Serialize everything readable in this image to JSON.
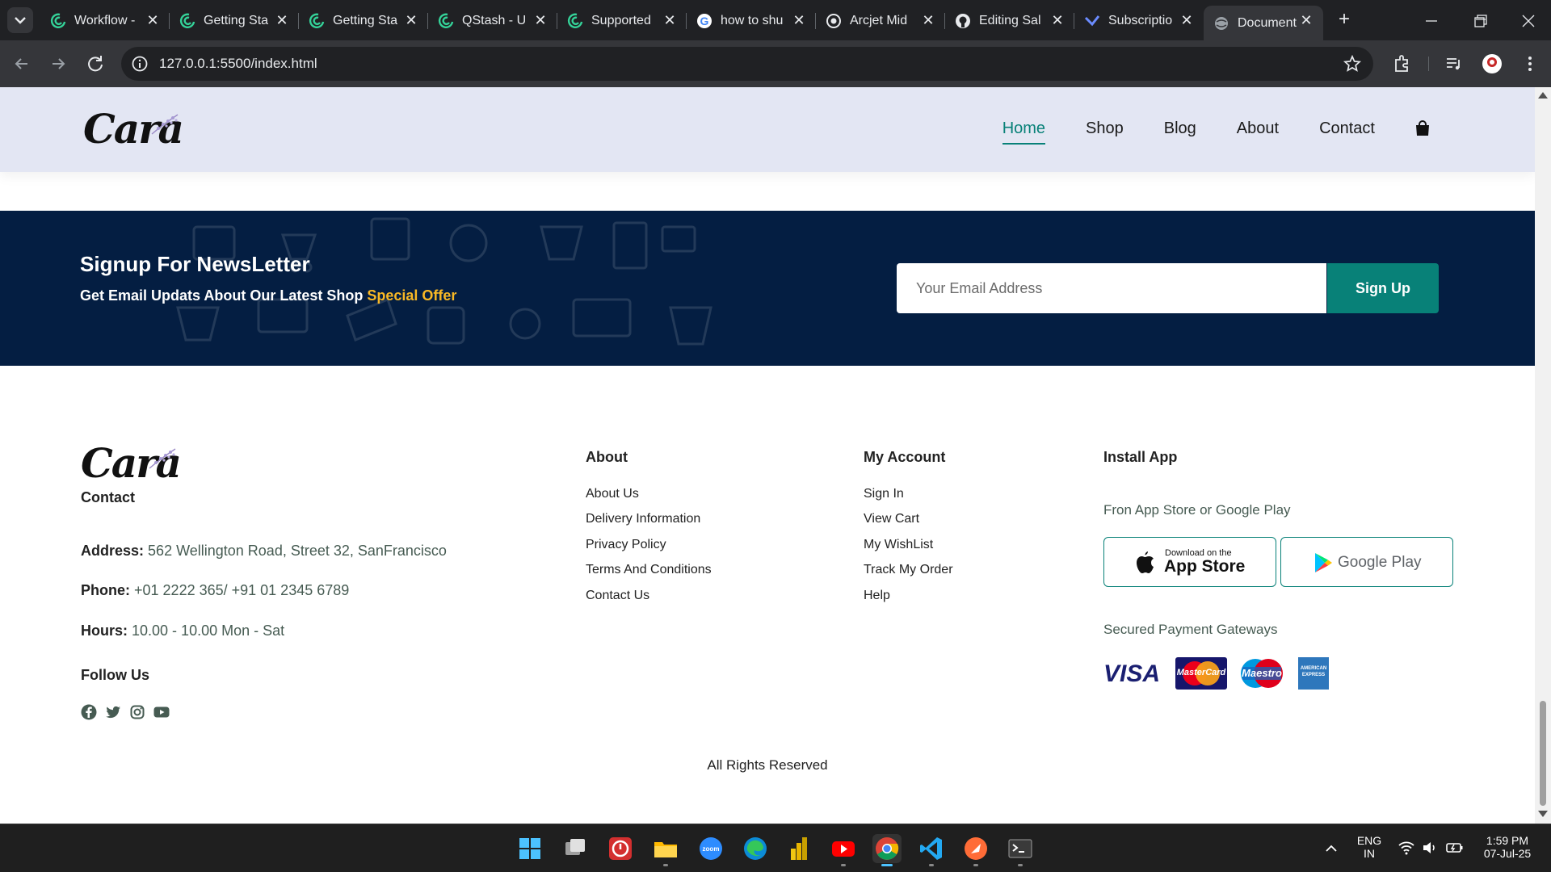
{
  "browser": {
    "tabs": [
      {
        "title": "Workflow -",
        "icon": "qstash-icon"
      },
      {
        "title": "Getting Sta",
        "icon": "qstash-icon"
      },
      {
        "title": "Getting Sta",
        "icon": "qstash-icon"
      },
      {
        "title": "QStash - U",
        "icon": "qstash-icon"
      },
      {
        "title": "Supported",
        "icon": "qstash-icon"
      },
      {
        "title": "how to shu",
        "icon": "google-icon"
      },
      {
        "title": "Arcjet Mid",
        "icon": "arcjet-icon"
      },
      {
        "title": "Editing Sal",
        "icon": "github-icon"
      },
      {
        "title": "Subscriptio",
        "icon": "subscription-icon"
      },
      {
        "title": "Document",
        "icon": "globe-icon",
        "active": true
      }
    ],
    "new_tab": "+",
    "url": "127.0.0.1:5500/index.html"
  },
  "site": {
    "logo": "Cara",
    "nav": [
      "Home",
      "Shop",
      "Blog",
      "About",
      "Contact"
    ],
    "newsletter": {
      "title": "Signup For NewsLetter",
      "subtitle": "Get Email Updats About Our Latest Shop",
      "highlight": "Special Offer",
      "placeholder": "Your Email Address",
      "button": "Sign Up"
    },
    "footer": {
      "contact_heading": "Contact",
      "address_label": "Address:",
      "address": "562 Wellington Road, Street 32, SanFrancisco",
      "phone_label": "Phone:",
      "phone": "+01 2222 365/ +91 01 2345 6789",
      "hours_label": "Hours:",
      "hours": "10.00 - 10.00 Mon - Sat",
      "follow": "Follow Us",
      "about_heading": "About",
      "about_links": [
        "About Us",
        "Delivery Information",
        "Privacy Policy",
        "Terms And Conditions",
        "Contact Us"
      ],
      "account_heading": "My Account",
      "account_links": [
        "Sign In",
        "View Cart",
        "My WishList",
        "Track My Order",
        "Help"
      ],
      "install_heading": "Install App",
      "install_sub": "Fron App Store or Google Play",
      "appstore_small": "Download on the",
      "appstore_big": "App Store",
      "googleplay": "Google Play",
      "payment_heading": "Secured Payment Gateways",
      "visa": "VISA",
      "mastercard": "MasterCard",
      "maestro": "Maestro",
      "amex": "AMERICAN EXPRESS",
      "rights": "All Rights Reserved"
    }
  },
  "taskbar": {
    "lang_top": "ENG",
    "lang_bottom": "IN",
    "time": "1:59 PM",
    "date": "07-Jul-25"
  },
  "colors": {
    "accent": "#088178",
    "newsletter_bg": "#041e42",
    "highlight": "#f9b825",
    "header_bg": "#e3e6f3"
  }
}
